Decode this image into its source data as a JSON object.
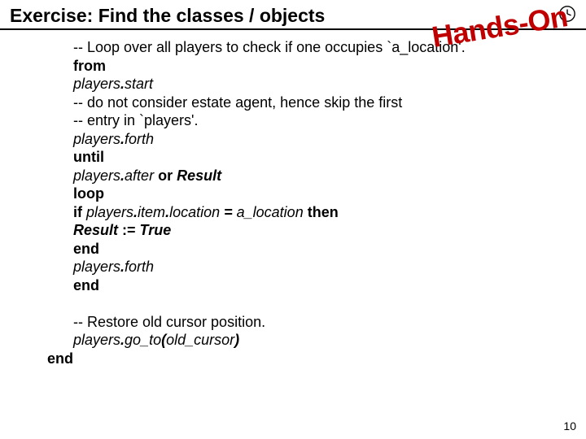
{
  "title": "Exercise: Find the classes / objects",
  "stamp": "Hands-On",
  "page_number": "10",
  "code": {
    "l1": "-- Loop over all players to check if one occupies `a_location'.",
    "l2": "from",
    "l3a": "players",
    "l3b": ".",
    "l3c": "start",
    "l4": "-- do not consider estate agent, hence skip the first",
    "l5": "-- entry in `players'.",
    "l6a": "players",
    "l6b": ".",
    "l6c": "forth",
    "l7": "until",
    "l8a": "players",
    "l8b": ".",
    "l8c": "after ",
    "l8d": "or ",
    "l8e": "Result",
    "l9": "loop",
    "l10a": "if ",
    "l10b": "players",
    "l10c": ".",
    "l10d": "item",
    "l10e": ".",
    "l10f": "location ",
    "l10g": "= ",
    "l10h": "a_location ",
    "l10i": "then",
    "l11a": "Result ",
    "l11b": ":= ",
    "l11c": "True",
    "l12": "end",
    "l13a": "players",
    "l13b": ".",
    "l13c": "forth",
    "l14": "end",
    "blank": " ",
    "l15": "-- Restore old cursor position.",
    "l16a": "players",
    "l16b": ".",
    "l16c": "go_to",
    "l16d": "(",
    "l16e": "old_cursor",
    "l16f": ")",
    "l17": "end"
  }
}
